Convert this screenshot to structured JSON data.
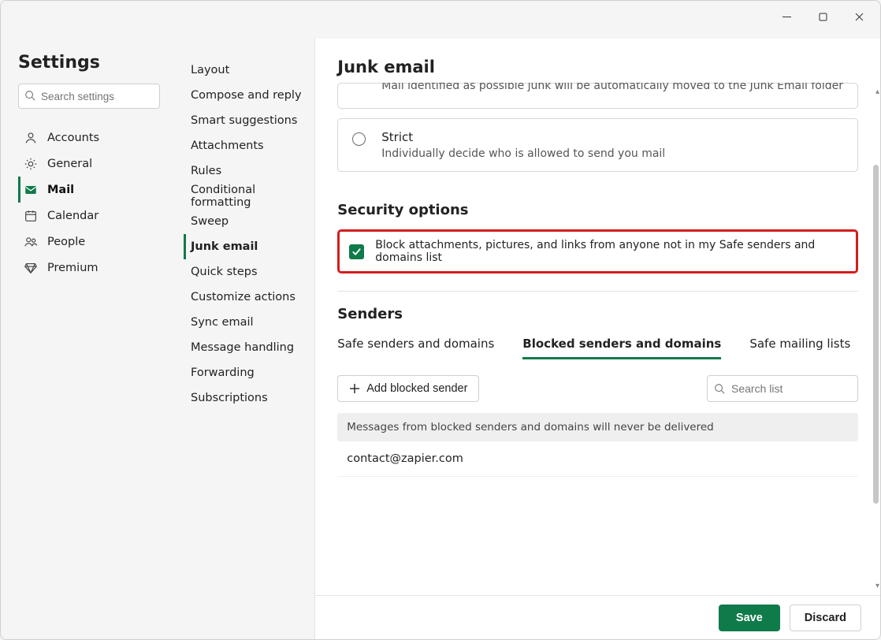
{
  "app_title": "Settings",
  "search_placeholder": "Search settings",
  "nav1": {
    "items": [
      {
        "label": "Accounts",
        "icon": "user"
      },
      {
        "label": "General",
        "icon": "gear"
      },
      {
        "label": "Mail",
        "icon": "mail",
        "active": true
      },
      {
        "label": "Calendar",
        "icon": "calendar"
      },
      {
        "label": "People",
        "icon": "people"
      },
      {
        "label": "Premium",
        "icon": "diamond"
      }
    ]
  },
  "nav2": {
    "items": [
      "Layout",
      "Compose and reply",
      "Smart suggestions",
      "Attachments",
      "Rules",
      "Conditional formatting",
      "Sweep",
      "Junk email",
      "Quick steps",
      "Customize actions",
      "Sync email",
      "Message handling",
      "Forwarding",
      "Subscriptions"
    ],
    "active_index": 7
  },
  "main": {
    "title": "Junk email",
    "options": [
      {
        "title": "",
        "desc": "Mail identified as possible junk will be automatically moved to the Junk Email folder",
        "truncated": true
      },
      {
        "title": "Strict",
        "desc": "Individually decide who is allowed to send you mail"
      }
    ],
    "security": {
      "heading": "Security options",
      "checkbox_label": "Block attachments, pictures, and links from anyone not in my Safe senders and domains list",
      "checked": true
    },
    "senders": {
      "heading": "Senders",
      "tabs": [
        "Safe senders and domains",
        "Blocked senders and domains",
        "Safe mailing lists"
      ],
      "active_tab": 1,
      "add_button": "Add blocked sender",
      "search_placeholder": "Search list",
      "info": "Messages from blocked senders and domains will never be delivered",
      "list": [
        "contact@zapier.com"
      ]
    }
  },
  "footer": {
    "save": "Save",
    "discard": "Discard"
  }
}
